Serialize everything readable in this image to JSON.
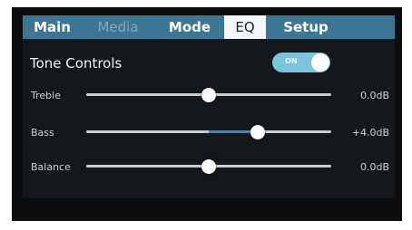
{
  "tabs": [
    {
      "label": "Main",
      "state": "normal"
    },
    {
      "label": "Media",
      "state": "disabled"
    },
    {
      "label": "Mode",
      "state": "normal"
    },
    {
      "label": "EQ",
      "state": "active"
    },
    {
      "label": "Setup",
      "state": "normal"
    }
  ],
  "tone_controls": {
    "title": "Tone Controls",
    "toggle_label": "ON",
    "enabled": true
  },
  "sliders": {
    "treble": {
      "label": "Treble",
      "value": "0.0dB",
      "level": 0.5
    },
    "bass": {
      "label": "Bass",
      "value": "+4.0dB",
      "level": 0.7
    },
    "balance": {
      "label": "Balance",
      "value": "0.0dB",
      "level": 0.5
    }
  },
  "colors": {
    "tab_bar": "#3d7695",
    "active_tab": "#f4f6f7",
    "toggle_on": "#7cc3de",
    "screen_bg": "#15181b",
    "slider_fill": "#4f86a8"
  }
}
